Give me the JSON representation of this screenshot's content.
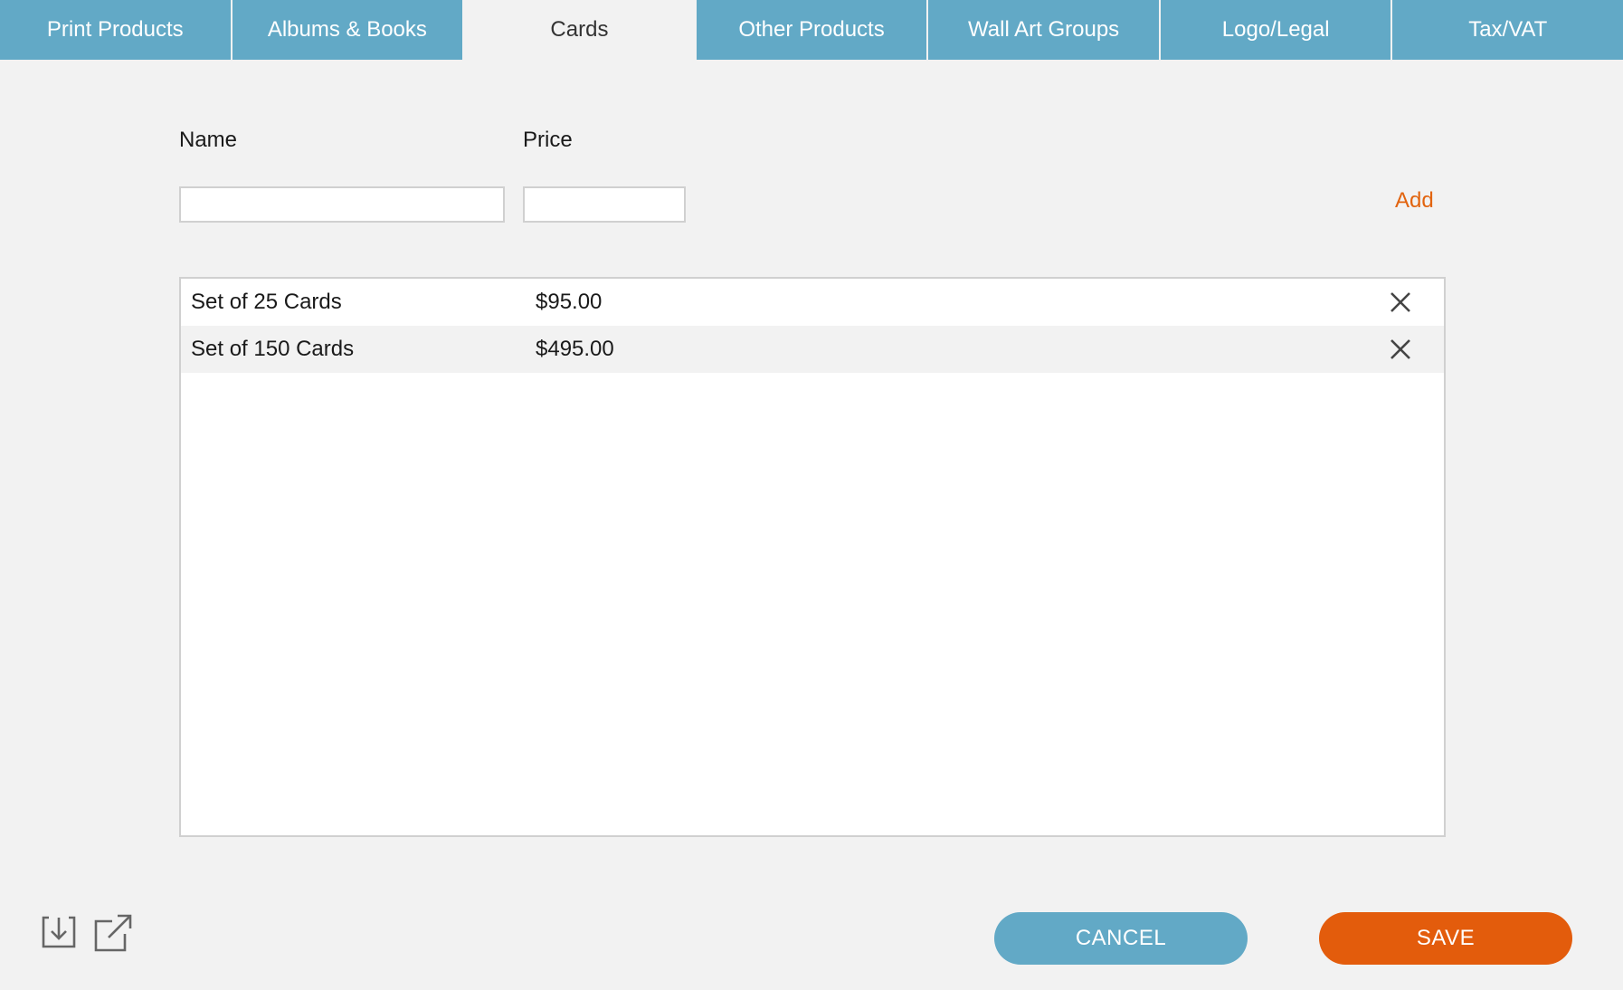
{
  "tabs": [
    {
      "label": "Print Products",
      "active": false
    },
    {
      "label": "Albums & Books",
      "active": false
    },
    {
      "label": "Cards",
      "active": true
    },
    {
      "label": "Other Products",
      "active": false
    },
    {
      "label": "Wall Art Groups",
      "active": false
    },
    {
      "label": "Logo/Legal",
      "active": false
    },
    {
      "label": "Tax/VAT",
      "active": false
    }
  ],
  "form": {
    "name_label": "Name",
    "price_label": "Price",
    "name_value": "",
    "price_value": "",
    "add_label": "Add"
  },
  "items": [
    {
      "name": "Set of 25 Cards",
      "price": "$95.00",
      "remove_icon": "close-icon"
    },
    {
      "name": "Set of 150 Cards",
      "price": "$495.00",
      "remove_icon": "close-icon"
    }
  ],
  "footer": {
    "import_icon": "import-icon",
    "export_icon": "export-icon",
    "cancel_label": "CANCEL",
    "save_label": "SAVE"
  },
  "colors": {
    "tab_bg": "#62a9c6",
    "accent": "#e35c0c",
    "background": "#f2f2f2"
  }
}
